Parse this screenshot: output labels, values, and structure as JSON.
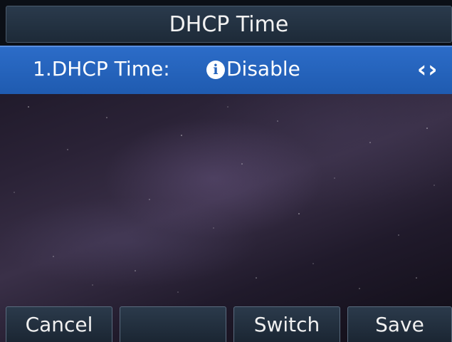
{
  "header": {
    "title": "DHCP Time"
  },
  "setting": {
    "label": "1.DHCP Time:",
    "info_icon": "i",
    "value": "Disable",
    "arrows": "‹›"
  },
  "softkeys": [
    {
      "label": "Cancel"
    },
    {
      "label": ""
    },
    {
      "label": "Switch"
    },
    {
      "label": "Save"
    }
  ],
  "colors": {
    "header_bg": "#1d2a38",
    "selected_row": "#2563bb",
    "softkey_bg": "#1b2633"
  }
}
